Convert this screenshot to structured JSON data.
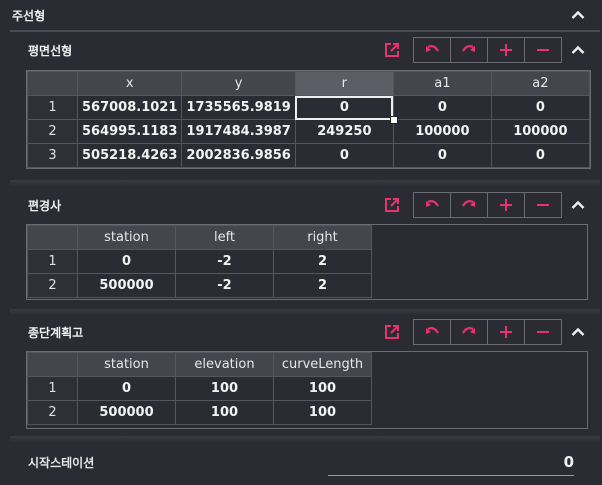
{
  "main": {
    "title": "주선형"
  },
  "colors": {
    "accent": "#e8336d",
    "background": "#2b2c33"
  },
  "icons": {
    "external": "external-link-icon",
    "undo": "undo-icon",
    "redo": "redo-icon",
    "add": "plus-icon",
    "remove": "minus-icon",
    "collapse": "chevron-up-icon"
  },
  "sections": {
    "plane": {
      "title": "평면선형",
      "columns": [
        "x",
        "y",
        "r",
        "a1",
        "a2"
      ],
      "rows": [
        {
          "n": "1",
          "cells": [
            "567008.1021",
            "1735565.9819",
            "0",
            "0",
            "0"
          ]
        },
        {
          "n": "2",
          "cells": [
            "564995.1183",
            "1917484.3987",
            "249250",
            "100000",
            "100000"
          ]
        },
        {
          "n": "3",
          "cells": [
            "505218.4263",
            "2002836.9856",
            "0",
            "0",
            "0"
          ]
        }
      ]
    },
    "offset": {
      "title": "편경사",
      "columns": [
        "station",
        "left",
        "right"
      ],
      "rows": [
        {
          "n": "1",
          "cells": [
            "0",
            "-2",
            "2"
          ]
        },
        {
          "n": "2",
          "cells": [
            "500000",
            "-2",
            "2"
          ]
        }
      ]
    },
    "profile": {
      "title": "종단계획고",
      "columns": [
        "station",
        "elevation",
        "curveLength"
      ],
      "rows": [
        {
          "n": "1",
          "cells": [
            "0",
            "100",
            "100"
          ]
        },
        {
          "n": "2",
          "cells": [
            "500000",
            "100",
            "100"
          ]
        }
      ]
    }
  },
  "start_station": {
    "label": "시작스테이션",
    "value": "0"
  }
}
